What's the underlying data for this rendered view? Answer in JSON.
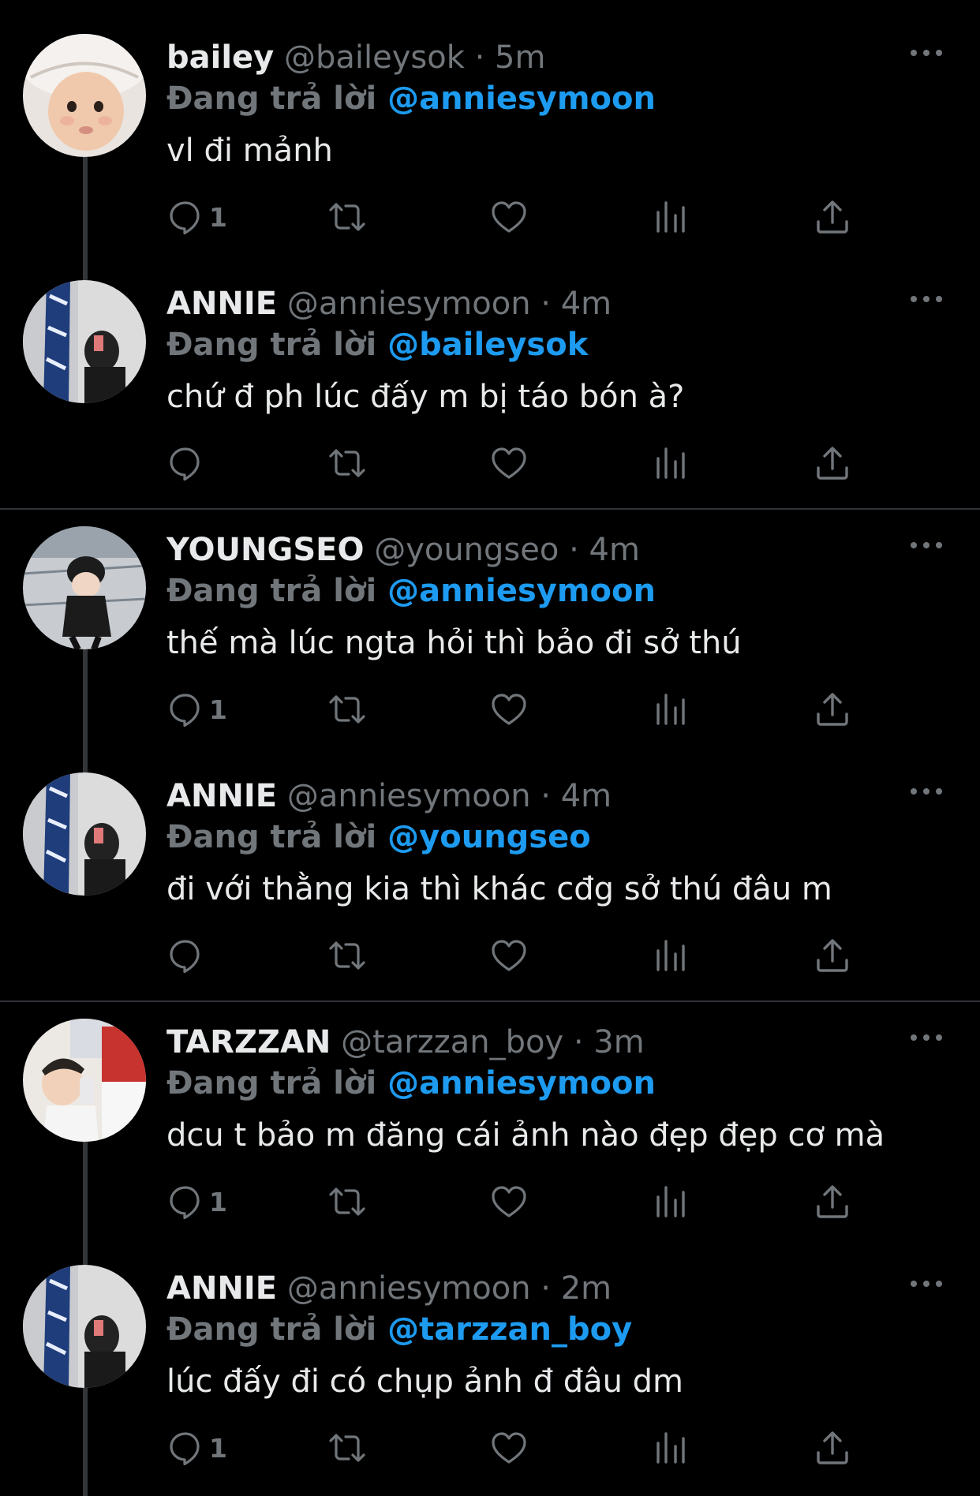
{
  "reply_prefix": "Đang trả lời",
  "tweets": [
    {
      "name": "bailey",
      "handle": "@baileysok",
      "time": "5m",
      "reply_to": "@anniesymoon",
      "text": "vl đi mảnh",
      "reply_count": "1",
      "avatar": "baby-photo"
    },
    {
      "name": "ANNIE",
      "handle": "@anniesymoon",
      "time": "4m",
      "reply_to": "@baileysok",
      "text": "chứ đ ph lúc đấy m bị táo bón à?",
      "reply_count": "",
      "avatar": "mirror-selfie"
    },
    {
      "name": "YOUNGSEO",
      "handle": "@youngseo",
      "time": "4m",
      "reply_to": "@anniesymoon",
      "text": "thế mà lúc ngta hỏi thì bảo đi sở thú",
      "reply_count": "1",
      "avatar": "beanie-photo"
    },
    {
      "name": "ANNIE",
      "handle": "@anniesymoon",
      "time": "4m",
      "reply_to": "@youngseo",
      "text": "đi với thằng kia thì khác cđg sở thú đâu m",
      "reply_count": "",
      "avatar": "mirror-selfie"
    },
    {
      "name": "TARZZAN",
      "handle": "@tarzzan_boy",
      "time": "3m",
      "reply_to": "@anniesymoon",
      "text": "dcu t bảo m đăng cái ảnh nào đẹp đẹp cơ mà",
      "reply_count": "1",
      "avatar": "selfie-photo"
    },
    {
      "name": "ANNIE",
      "handle": "@anniesymoon",
      "time": "2m",
      "reply_to": "@tarzzan_boy",
      "text": "lúc đấy đi có chụp ảnh đ đâu dm",
      "reply_count": "1",
      "avatar": "mirror-selfie"
    }
  ],
  "colors": {
    "background": "#000000",
    "name": "#e7e9ea",
    "muted": "#71767b",
    "mention": "#1d9bf0",
    "thread_line": "#333639",
    "divider": "#2f3336"
  }
}
